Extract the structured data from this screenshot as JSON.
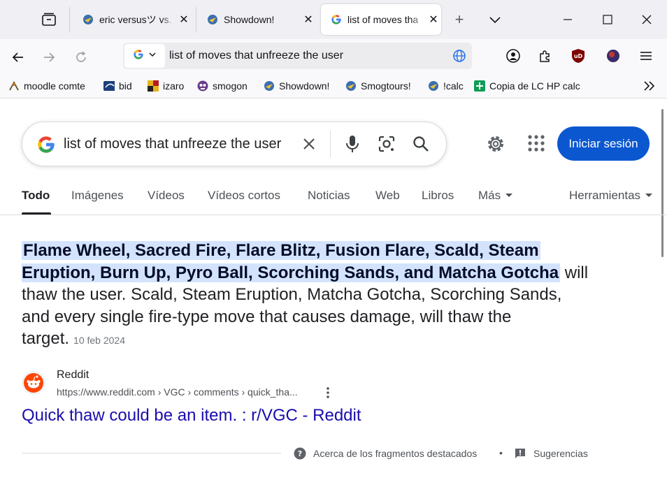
{
  "browser": {
    "tabs": [
      {
        "title": "eric versusツ vs.",
        "active": false
      },
      {
        "title": "Showdown!",
        "active": false
      },
      {
        "title": "list of moves tha",
        "active": true
      }
    ],
    "new_tab_label": "+",
    "close_symbol": "✕",
    "url": "list of moves that unfreeze the user",
    "bookmarks": [
      "moodle comte",
      "bid",
      "izaro",
      "smogon",
      "Showdown!",
      "Smogtours!",
      "!calc",
      "Copia de LC HP calc"
    ]
  },
  "google": {
    "query": "list of moves that unfreeze the user",
    "signin_label": "Iniciar sesión",
    "tabs": [
      "Todo",
      "Imágenes",
      "Vídeos",
      "Vídeos cortos",
      "Noticias",
      "Web",
      "Libros",
      "Más"
    ],
    "active_tab": "Todo",
    "tools_label": "Herramientas",
    "featured_snippet": {
      "highlight_line1": "Flame Wheel, Sacred Fire, Flare Blitz, Fusion Flare, Scald, Steam",
      "highlight_line2": "Eruption, Burn Up, Pyro Ball, Scorching Sands, and Matcha Gotcha",
      "rest_line2": " will",
      "line3": "thaw the user. Scald, Steam Eruption, Matcha Gotcha, Scorching Sands,",
      "line4": "and every single fire-type move that causes damage, will thaw the",
      "line5": "target.",
      "date": "10 feb 2024"
    },
    "source": {
      "name": "Reddit",
      "url": "https://www.reddit.com › VGC › comments › quick_tha...",
      "title": "Quick thaw could be an item. : r/VGC - Reddit"
    },
    "footer": {
      "about": "Acerca de los fragmentos destacados",
      "separator": "•",
      "feedback": "Sugerencias"
    }
  },
  "colors": {
    "google_blue": "#0b57d0",
    "link_blue": "#1a0dab",
    "highlight": "#d3e3fd"
  }
}
